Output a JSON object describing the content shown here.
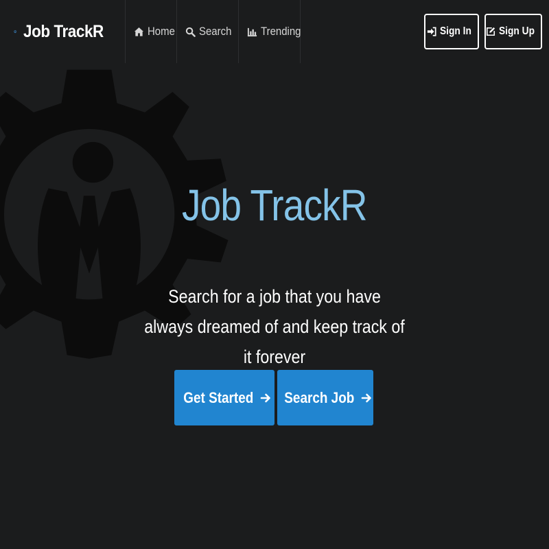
{
  "brand": {
    "title": "Job TrackR",
    "logo_icon": "gear-person-logo",
    "accent_color": "#3b86c8"
  },
  "nav": {
    "items": [
      {
        "label": "Home",
        "icon": "home-icon"
      },
      {
        "label": "Search",
        "icon": "search-icon"
      },
      {
        "label": "Trending",
        "icon": "bar-chart-icon"
      }
    ]
  },
  "auth": {
    "sign_in": {
      "label": "Sign In",
      "icon": "sign-in-icon"
    },
    "sign_up": {
      "label": "Sign Up",
      "icon": "edit-icon"
    }
  },
  "hero": {
    "title": "Job TrackR",
    "subtitle": "Search for a job that you have always dreamed of and keep track of it forever",
    "title_color": "#84c3e8",
    "actions": [
      {
        "label": "Get Started",
        "icon": "arrow-right-icon"
      },
      {
        "label": "Search Job",
        "icon": "arrow-right-icon"
      }
    ],
    "button_color": "#2185d0"
  },
  "colors": {
    "background": "#1b1c1d",
    "background_logo": "#0d0d0d"
  }
}
